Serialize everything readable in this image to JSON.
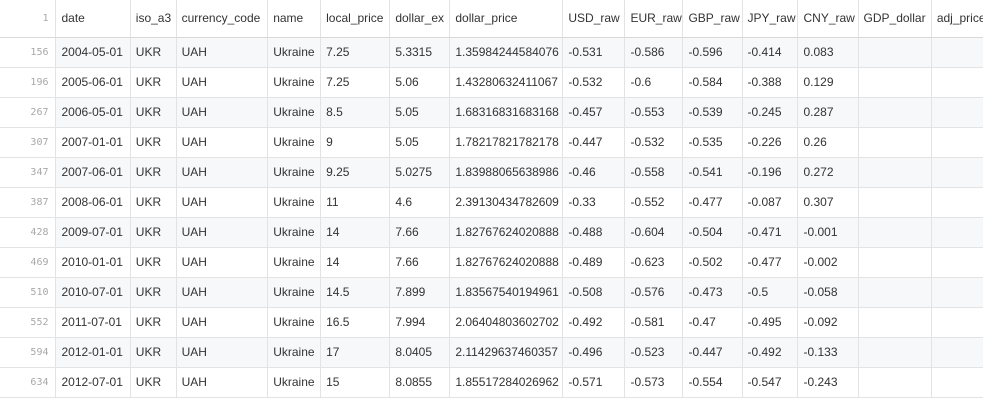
{
  "header": {
    "line_number": "1",
    "columns": [
      "date",
      "iso_a3",
      "currency_code",
      "name",
      "local_price",
      "dollar_ex",
      "dollar_price",
      "USD_raw",
      "EUR_raw",
      "GBP_raw",
      "JPY_raw",
      "CNY_raw",
      "GDP_dollar",
      "adj_price"
    ]
  },
  "rows": [
    {
      "line": "156",
      "cells": [
        "2004-05-01",
        "UKR",
        "UAH",
        "Ukraine",
        "7.25",
        "5.3315",
        "1.35984244584076",
        "-0.531",
        "-0.586",
        "-0.596",
        "-0.414",
        "0.083",
        "",
        ""
      ]
    },
    {
      "line": "196",
      "cells": [
        "2005-06-01",
        "UKR",
        "UAH",
        "Ukraine",
        "7.25",
        "5.06",
        "1.43280632411067",
        "-0.532",
        "-0.6",
        "-0.584",
        "-0.388",
        "0.129",
        "",
        ""
      ]
    },
    {
      "line": "267",
      "cells": [
        "2006-05-01",
        "UKR",
        "UAH",
        "Ukraine",
        "8.5",
        "5.05",
        "1.68316831683168",
        "-0.457",
        "-0.553",
        "-0.539",
        "-0.245",
        "0.287",
        "",
        ""
      ]
    },
    {
      "line": "307",
      "cells": [
        "2007-01-01",
        "UKR",
        "UAH",
        "Ukraine",
        "9",
        "5.05",
        "1.78217821782178",
        "-0.447",
        "-0.532",
        "-0.535",
        "-0.226",
        "0.26",
        "",
        ""
      ]
    },
    {
      "line": "347",
      "cells": [
        "2007-06-01",
        "UKR",
        "UAH",
        "Ukraine",
        "9.25",
        "5.0275",
        "1.83988065638986",
        "-0.46",
        "-0.558",
        "-0.541",
        "-0.196",
        "0.272",
        "",
        ""
      ]
    },
    {
      "line": "387",
      "cells": [
        "2008-06-01",
        "UKR",
        "UAH",
        "Ukraine",
        "11",
        "4.6",
        "2.39130434782609",
        "-0.33",
        "-0.552",
        "-0.477",
        "-0.087",
        "0.307",
        "",
        ""
      ]
    },
    {
      "line": "428",
      "cells": [
        "2009-07-01",
        "UKR",
        "UAH",
        "Ukraine",
        "14",
        "7.66",
        "1.82767624020888",
        "-0.488",
        "-0.604",
        "-0.504",
        "-0.471",
        "-0.001",
        "",
        ""
      ]
    },
    {
      "line": "469",
      "cells": [
        "2010-01-01",
        "UKR",
        "UAH",
        "Ukraine",
        "14",
        "7.66",
        "1.82767624020888",
        "-0.489",
        "-0.623",
        "-0.502",
        "-0.477",
        "-0.002",
        "",
        ""
      ]
    },
    {
      "line": "510",
      "cells": [
        "2010-07-01",
        "UKR",
        "UAH",
        "Ukraine",
        "14.5",
        "7.899",
        "1.83567540194961",
        "-0.508",
        "-0.576",
        "-0.473",
        "-0.5",
        "-0.058",
        "",
        ""
      ]
    },
    {
      "line": "552",
      "cells": [
        "2011-07-01",
        "UKR",
        "UAH",
        "Ukraine",
        "16.5",
        "7.994",
        "2.06404803602702",
        "-0.492",
        "-0.581",
        "-0.47",
        "-0.495",
        "-0.092",
        "",
        ""
      ]
    },
    {
      "line": "594",
      "cells": [
        "2012-01-01",
        "UKR",
        "UAH",
        "Ukraine",
        "17",
        "8.0405",
        "2.11429637460357",
        "-0.496",
        "-0.523",
        "-0.447",
        "-0.492",
        "-0.133",
        "",
        ""
      ]
    },
    {
      "line": "634",
      "cells": [
        "2012-07-01",
        "UKR",
        "UAH",
        "Ukraine",
        "15",
        "8.0855",
        "1.85517284026962",
        "-0.571",
        "-0.573",
        "-0.554",
        "-0.547",
        "-0.243",
        "",
        ""
      ]
    }
  ]
}
